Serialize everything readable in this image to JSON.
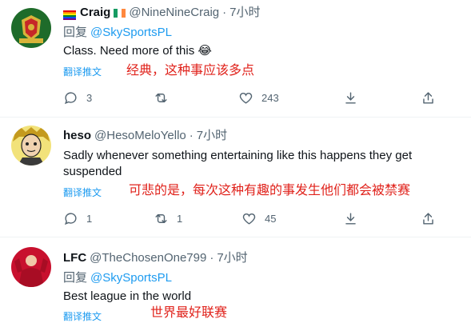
{
  "tweets": [
    {
      "name": "Craig",
      "handle": "@NineNineCraig",
      "time": "7小时",
      "reply_prefix": "回复",
      "reply_to": "@SkySportsPL",
      "text": "Class. Need more of this 😂",
      "translate_label": "翻译推文",
      "translation": "经典，这种事应该多点",
      "replies": "3",
      "retweets": "",
      "likes": "243"
    },
    {
      "name": "heso",
      "handle": "@HesoMeloYello",
      "time": "7小时",
      "text": "Sadly whenever something entertaining like this happens they get suspended",
      "translate_label": "翻译推文",
      "translation": "可悲的是，每次这种有趣的事发生他们都会被禁赛",
      "replies": "1",
      "retweets": "1",
      "likes": "45"
    },
    {
      "name": "LFC",
      "handle": "@TheChosenOne799",
      "time": "7小时",
      "reply_prefix": "回复",
      "reply_to": "@SkySportsPL",
      "text": "Best league in the world",
      "translate_label": "翻译推文",
      "translation": "世界最好联赛"
    }
  ],
  "colors": {
    "accent": "#1d9bf0",
    "muted": "#536471",
    "translation": "#e0221b"
  },
  "icons": [
    "reply-icon",
    "retweet-icon",
    "like-icon",
    "bookmark-icon",
    "share-icon"
  ]
}
